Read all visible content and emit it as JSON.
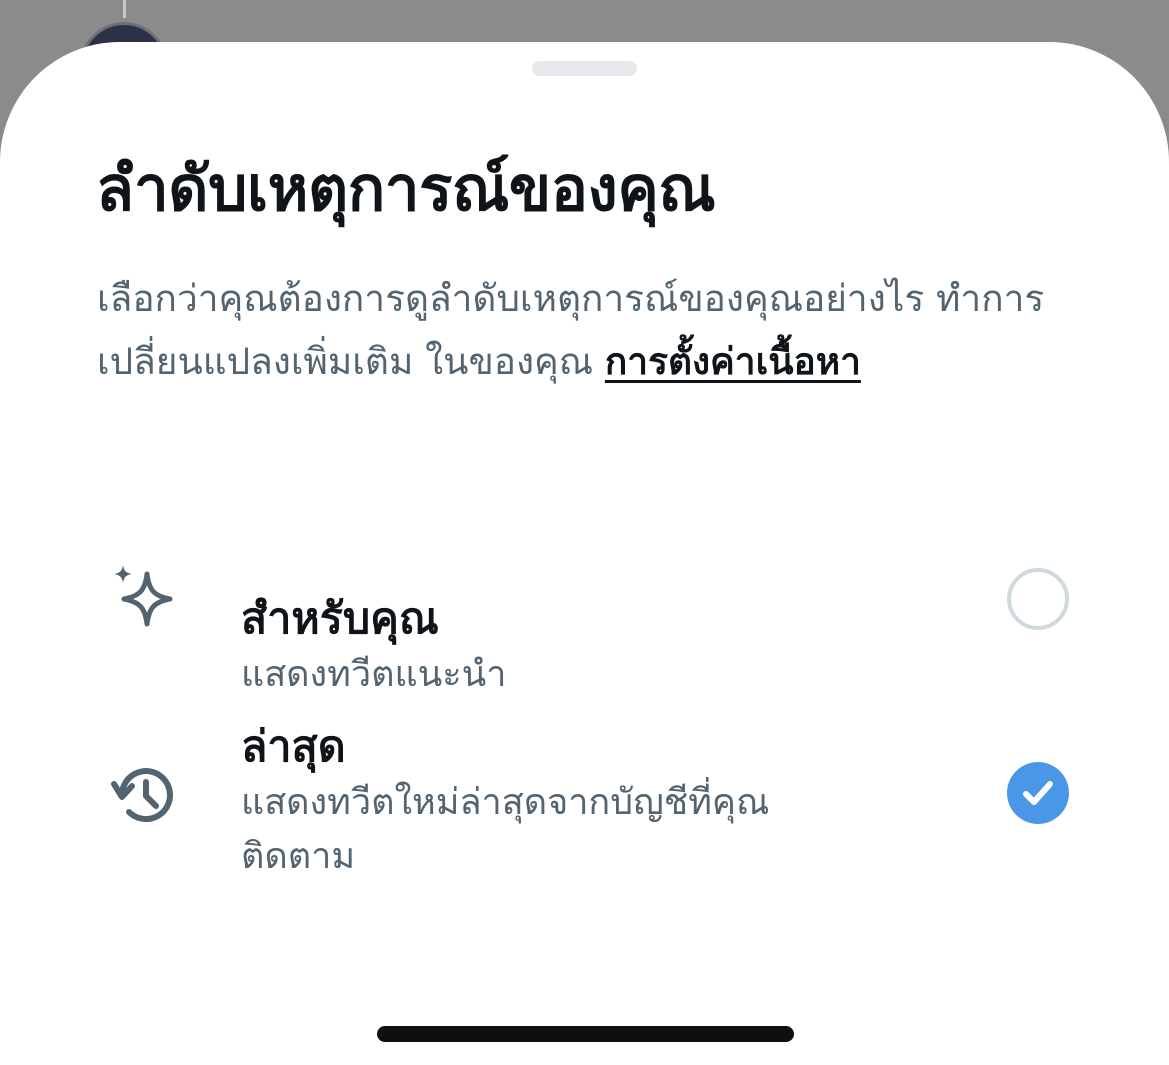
{
  "sheet": {
    "title": "ลำดับเหตุการณ์ของคุณ",
    "description_text": "เลือกว่าคุณต้องการดูลำดับเหตุการณ์ของคุณอย่างไร ทำการเปลี่ยนแปลงเพิ่มเติม ในของคุณ ",
    "description_link": "การตั้งค่าเนื้อหา"
  },
  "options": [
    {
      "title": "สำหรับคุณ",
      "subtitle": "แสดงทวีตแนะนำ",
      "icon": "sparkle-icon",
      "selected": false
    },
    {
      "title": "ล่าสุด",
      "subtitle": "แสดงทวีตใหม่ล่าสุดจากบัญชีที่คุณติดตาม",
      "icon": "history-icon",
      "selected": true
    }
  ],
  "colors": {
    "accent": "#4a97e8",
    "text_primary": "#0f1419",
    "text_secondary": "#536471",
    "radio_off_border": "#cfd9de"
  }
}
